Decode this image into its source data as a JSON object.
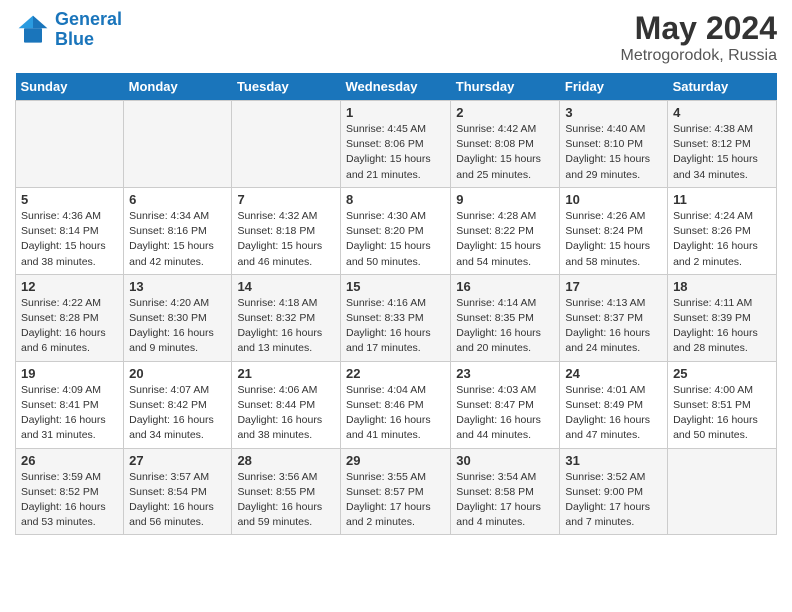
{
  "header": {
    "logo_line1": "General",
    "logo_line2": "Blue",
    "title": "May 2024",
    "subtitle": "Metrogorodok, Russia"
  },
  "columns": [
    "Sunday",
    "Monday",
    "Tuesday",
    "Wednesday",
    "Thursday",
    "Friday",
    "Saturday"
  ],
  "weeks": [
    [
      {
        "day": "",
        "info": ""
      },
      {
        "day": "",
        "info": ""
      },
      {
        "day": "",
        "info": ""
      },
      {
        "day": "1",
        "info": "Sunrise: 4:45 AM\nSunset: 8:06 PM\nDaylight: 15 hours\nand 21 minutes."
      },
      {
        "day": "2",
        "info": "Sunrise: 4:42 AM\nSunset: 8:08 PM\nDaylight: 15 hours\nand 25 minutes."
      },
      {
        "day": "3",
        "info": "Sunrise: 4:40 AM\nSunset: 8:10 PM\nDaylight: 15 hours\nand 29 minutes."
      },
      {
        "day": "4",
        "info": "Sunrise: 4:38 AM\nSunset: 8:12 PM\nDaylight: 15 hours\nand 34 minutes."
      }
    ],
    [
      {
        "day": "5",
        "info": "Sunrise: 4:36 AM\nSunset: 8:14 PM\nDaylight: 15 hours\nand 38 minutes."
      },
      {
        "day": "6",
        "info": "Sunrise: 4:34 AM\nSunset: 8:16 PM\nDaylight: 15 hours\nand 42 minutes."
      },
      {
        "day": "7",
        "info": "Sunrise: 4:32 AM\nSunset: 8:18 PM\nDaylight: 15 hours\nand 46 minutes."
      },
      {
        "day": "8",
        "info": "Sunrise: 4:30 AM\nSunset: 8:20 PM\nDaylight: 15 hours\nand 50 minutes."
      },
      {
        "day": "9",
        "info": "Sunrise: 4:28 AM\nSunset: 8:22 PM\nDaylight: 15 hours\nand 54 minutes."
      },
      {
        "day": "10",
        "info": "Sunrise: 4:26 AM\nSunset: 8:24 PM\nDaylight: 15 hours\nand 58 minutes."
      },
      {
        "day": "11",
        "info": "Sunrise: 4:24 AM\nSunset: 8:26 PM\nDaylight: 16 hours\nand 2 minutes."
      }
    ],
    [
      {
        "day": "12",
        "info": "Sunrise: 4:22 AM\nSunset: 8:28 PM\nDaylight: 16 hours\nand 6 minutes."
      },
      {
        "day": "13",
        "info": "Sunrise: 4:20 AM\nSunset: 8:30 PM\nDaylight: 16 hours\nand 9 minutes."
      },
      {
        "day": "14",
        "info": "Sunrise: 4:18 AM\nSunset: 8:32 PM\nDaylight: 16 hours\nand 13 minutes."
      },
      {
        "day": "15",
        "info": "Sunrise: 4:16 AM\nSunset: 8:33 PM\nDaylight: 16 hours\nand 17 minutes."
      },
      {
        "day": "16",
        "info": "Sunrise: 4:14 AM\nSunset: 8:35 PM\nDaylight: 16 hours\nand 20 minutes."
      },
      {
        "day": "17",
        "info": "Sunrise: 4:13 AM\nSunset: 8:37 PM\nDaylight: 16 hours\nand 24 minutes."
      },
      {
        "day": "18",
        "info": "Sunrise: 4:11 AM\nSunset: 8:39 PM\nDaylight: 16 hours\nand 28 minutes."
      }
    ],
    [
      {
        "day": "19",
        "info": "Sunrise: 4:09 AM\nSunset: 8:41 PM\nDaylight: 16 hours\nand 31 minutes."
      },
      {
        "day": "20",
        "info": "Sunrise: 4:07 AM\nSunset: 8:42 PM\nDaylight: 16 hours\nand 34 minutes."
      },
      {
        "day": "21",
        "info": "Sunrise: 4:06 AM\nSunset: 8:44 PM\nDaylight: 16 hours\nand 38 minutes."
      },
      {
        "day": "22",
        "info": "Sunrise: 4:04 AM\nSunset: 8:46 PM\nDaylight: 16 hours\nand 41 minutes."
      },
      {
        "day": "23",
        "info": "Sunrise: 4:03 AM\nSunset: 8:47 PM\nDaylight: 16 hours\nand 44 minutes."
      },
      {
        "day": "24",
        "info": "Sunrise: 4:01 AM\nSunset: 8:49 PM\nDaylight: 16 hours\nand 47 minutes."
      },
      {
        "day": "25",
        "info": "Sunrise: 4:00 AM\nSunset: 8:51 PM\nDaylight: 16 hours\nand 50 minutes."
      }
    ],
    [
      {
        "day": "26",
        "info": "Sunrise: 3:59 AM\nSunset: 8:52 PM\nDaylight: 16 hours\nand 53 minutes."
      },
      {
        "day": "27",
        "info": "Sunrise: 3:57 AM\nSunset: 8:54 PM\nDaylight: 16 hours\nand 56 minutes."
      },
      {
        "day": "28",
        "info": "Sunrise: 3:56 AM\nSunset: 8:55 PM\nDaylight: 16 hours\nand 59 minutes."
      },
      {
        "day": "29",
        "info": "Sunrise: 3:55 AM\nSunset: 8:57 PM\nDaylight: 17 hours\nand 2 minutes."
      },
      {
        "day": "30",
        "info": "Sunrise: 3:54 AM\nSunset: 8:58 PM\nDaylight: 17 hours\nand 4 minutes."
      },
      {
        "day": "31",
        "info": "Sunrise: 3:52 AM\nSunset: 9:00 PM\nDaylight: 17 hours\nand 7 minutes."
      },
      {
        "day": "",
        "info": ""
      }
    ]
  ]
}
